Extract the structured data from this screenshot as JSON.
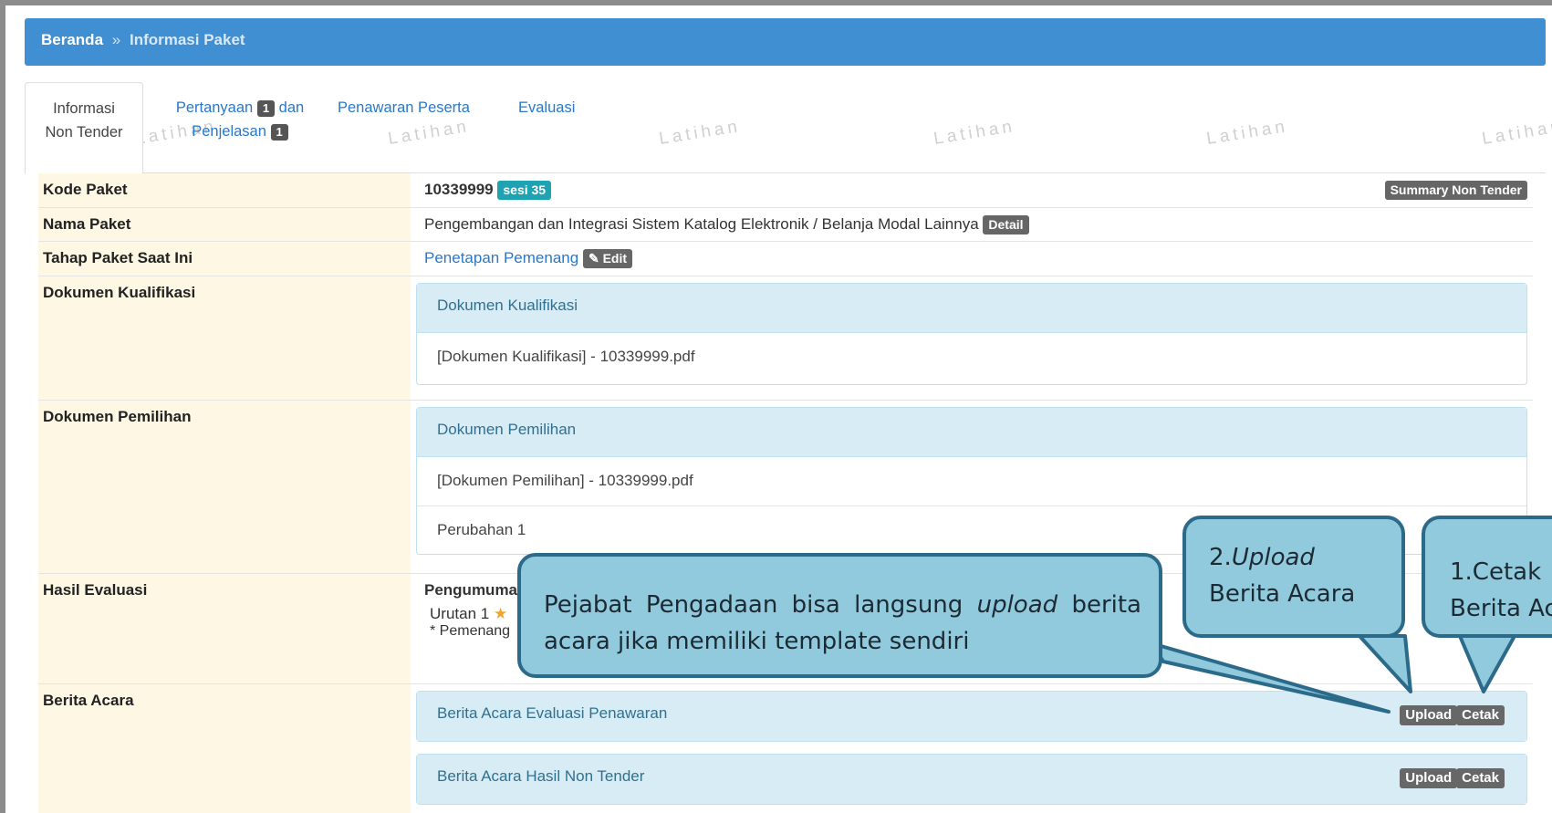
{
  "watermark": "Latihan",
  "breadcrumb": {
    "home": "Beranda",
    "separator": "»",
    "current": "Informasi Paket"
  },
  "tabs": [
    {
      "line1": "Informasi",
      "line2": "Non Tender"
    },
    {
      "line1_a": "Pertanyaan",
      "badge1": "1",
      "line1_b": "dan",
      "line2": "Penjelasan",
      "badge2": "1"
    },
    {
      "label": "Penawaran Peserta"
    },
    {
      "label": "Evaluasi"
    }
  ],
  "rows": {
    "kode": {
      "label": "Kode Paket",
      "value": "10339999",
      "sesi": "sesi 35",
      "summary": "Summary Non Tender"
    },
    "nama": {
      "label": "Nama Paket",
      "value": "Pengembangan dan Integrasi Sistem Katalog Elektronik / Belanja Modal Lainnya",
      "detail": "Detail"
    },
    "tahap": {
      "label": "Tahap Paket Saat Ini",
      "value": "Penetapan Pemenang",
      "edit": "Edit"
    },
    "kualifikasi": {
      "label": "Dokumen Kualifikasi",
      "panel_title": "Dokumen Kualifikasi",
      "file": "[Dokumen Kualifikasi] - 10339999.pdf"
    },
    "pemilihan": {
      "label": "Dokumen Pemilihan",
      "panel_title": "Dokumen Pemilihan",
      "file": "[Dokumen Pemilihan] - 10339999.pdf",
      "perubahan": "Perubahan 1"
    },
    "evaluasi": {
      "label": "Hasil Evaluasi",
      "heading": "Pengumuma",
      "urutan": "Urutan 1",
      "note": "* Pemenang"
    },
    "berita": {
      "label": "Berita Acara",
      "items": [
        {
          "title": "Berita Acara Evaluasi Penawaran",
          "upload": "Upload",
          "cetak": "Cetak"
        },
        {
          "title": "Berita Acara Hasil Non Tender",
          "upload": "Upload",
          "cetak": "Cetak"
        }
      ]
    }
  },
  "callouts": {
    "main": {
      "pre": "Pejabat Pengadaan bisa langsung ",
      "em": "upload",
      "post": " berita",
      "line2": "acara jika memiliki template sendiri"
    },
    "upload": {
      "num": "2.",
      "em": "Upload",
      "line2": "Berita Acara"
    },
    "cetak": {
      "line1": "1.Cetak",
      "line2": "Berita Ac"
    }
  },
  "colors": {
    "header": "#3f8fd2",
    "label_bg": "#fdf7e3",
    "panel_head": "#d7ecf5",
    "callout": "#92cadd",
    "callout_border": "#2c6a8a"
  }
}
